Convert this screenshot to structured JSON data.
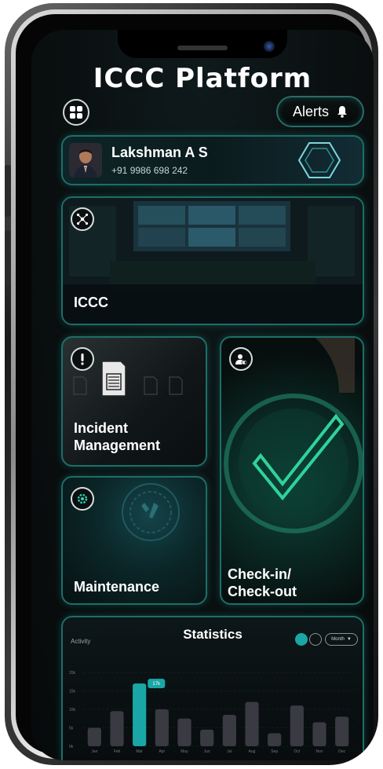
{
  "app": {
    "title": "ICCC Platform"
  },
  "header": {
    "alerts_label": "Alerts"
  },
  "profile": {
    "name": "Lakshman A S",
    "phone": "+91 9986 698 242"
  },
  "modules": [
    {
      "label": "ICCC",
      "icon": "network-icon"
    },
    {
      "label": "Incident\nManagement",
      "icon": "exclamation-icon"
    },
    {
      "label": "Check-in/\nCheck-out",
      "icon": "user-toggle-icon"
    },
    {
      "label": "Maintenance",
      "icon": "gear-icon"
    }
  ],
  "statistics": {
    "title": "Statistics",
    "activity_label": "Activity",
    "period": "Month",
    "highlight_label": "17k"
  },
  "chart_data": {
    "type": "bar",
    "title": "Statistics",
    "ylabel": "Activity",
    "categories": [
      "Jan",
      "Feb",
      "Mar",
      "Apr",
      "May",
      "Jun",
      "Jul",
      "Aug",
      "Sep",
      "Oct",
      "Nov",
      "Dec"
    ],
    "values": [
      5,
      9.5,
      17,
      10,
      7.5,
      4.5,
      8.5,
      12,
      3.5,
      11,
      6.5,
      8
    ],
    "ylim": [
      0,
      20
    ],
    "yticks": [
      "0k",
      "5k",
      "10k",
      "15k",
      "20k"
    ],
    "highlight_index": 2,
    "colors": {
      "bar": "#3a3a42",
      "highlight": "#1aa6a6"
    }
  }
}
